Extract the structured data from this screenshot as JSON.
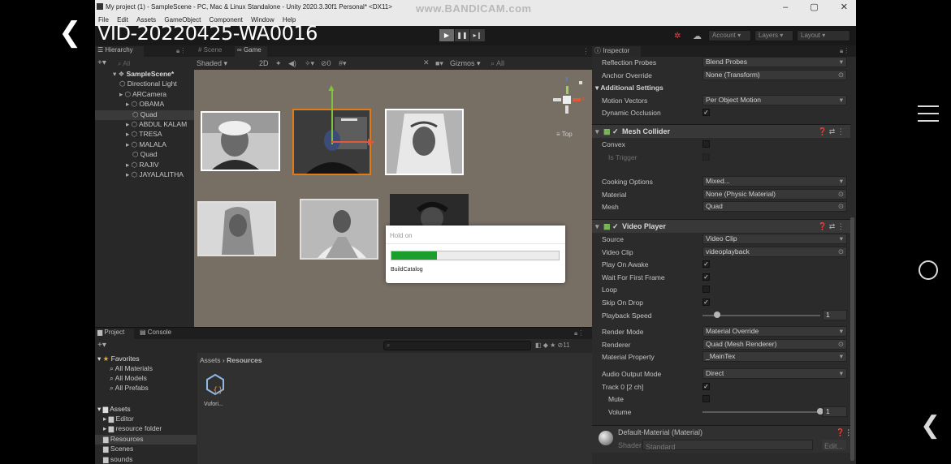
{
  "overlay": {
    "video_title": "VID-20220425-WA0016",
    "watermark": "www.BANDICAM.com"
  },
  "window": {
    "title": "My project (1) - SampleScene - PC, Mac & Linux Standalone - Unity 2020.3.30f1 Personal* <DX11>",
    "controls": [
      "–",
      "▢",
      "✕"
    ]
  },
  "menu": [
    "File",
    "Edit",
    "Assets",
    "GameObject",
    "Component",
    "Window",
    "Help"
  ],
  "toolbar": {
    "account": "Account",
    "layers": "Layers",
    "layout": "Layout"
  },
  "hierarchy": {
    "tab": "Hierarchy",
    "search_placeholder": "All",
    "items": [
      {
        "label": "SampleScene*",
        "depth": 0,
        "bold": true
      },
      {
        "label": "Directional Light",
        "depth": 1
      },
      {
        "label": "ARCamera",
        "depth": 1
      },
      {
        "label": "OBAMA",
        "depth": 2
      },
      {
        "label": "Quad",
        "depth": 3,
        "selected": true
      },
      {
        "label": "ABDUL KALAM",
        "depth": 2
      },
      {
        "label": "TRESA",
        "depth": 2
      },
      {
        "label": "MALALA",
        "depth": 2
      },
      {
        "label": "Quad",
        "depth": 3
      },
      {
        "label": "RAJIV",
        "depth": 2
      },
      {
        "label": "JAYALALITHA",
        "depth": 2
      }
    ]
  },
  "scene": {
    "tabs": [
      "Scene",
      "Game"
    ],
    "shading": "Shaded",
    "mode_2d": "2D",
    "gizmos": "Gizmos",
    "search_placeholder": "All",
    "gizmo_label": "Top"
  },
  "dialog": {
    "title": "Hold on",
    "progress": 0.27,
    "status": "BuildCatalog"
  },
  "inspector": {
    "tab": "Inspector",
    "rows_top": [
      {
        "label": "Reflection Probes",
        "value": "Blend Probes",
        "kind": "dropdown"
      },
      {
        "label": "Anchor Override",
        "value": "None (Transform)",
        "kind": "object"
      }
    ],
    "additional_settings": "Additional Settings",
    "rows_additional": [
      {
        "label": "Motion Vectors",
        "value": "Per Object Motion",
        "kind": "dropdown"
      },
      {
        "label": "Dynamic Occlusion",
        "value": "✓",
        "kind": "check"
      }
    ],
    "mesh_collider": {
      "title": "Mesh Collider",
      "rows": [
        {
          "label": "Convex",
          "value": "",
          "kind": "check"
        },
        {
          "label": "Is Trigger",
          "value": "",
          "kind": "check",
          "dim": true
        },
        {
          "label": "Cooking Options",
          "value": "Mixed...",
          "kind": "dropdown"
        },
        {
          "label": "Material",
          "value": "None (Physic Material)",
          "kind": "object"
        },
        {
          "label": "Mesh",
          "value": "Quad",
          "kind": "object"
        }
      ]
    },
    "video_player": {
      "title": "Video Player",
      "rows": [
        {
          "label": "Source",
          "value": "Video Clip",
          "kind": "dropdown"
        },
        {
          "label": "Video Clip",
          "value": "videoplayback",
          "kind": "object"
        },
        {
          "label": "Play On Awake",
          "value": "✓",
          "kind": "check"
        },
        {
          "label": "Wait For First Frame",
          "value": "✓",
          "kind": "check"
        },
        {
          "label": "Loop",
          "value": "",
          "kind": "check"
        },
        {
          "label": "Skip On Drop",
          "value": "✓",
          "kind": "check"
        },
        {
          "label": "Playback Speed",
          "value": "1",
          "kind": "slider",
          "level": 0.1
        },
        {
          "label": "Render Mode",
          "value": "Material Override",
          "kind": "dropdown"
        },
        {
          "label": "Renderer",
          "value": "Quad (Mesh Renderer)",
          "kind": "object"
        },
        {
          "label": "Material Property",
          "value": "_MainTex",
          "kind": "dropdown"
        },
        {
          "label": "Audio Output Mode",
          "value": "Direct",
          "kind": "dropdown"
        },
        {
          "label": "Track 0 [2 ch]",
          "value": "✓",
          "kind": "check"
        },
        {
          "label": "Mute",
          "value": "",
          "kind": "check",
          "indent": true
        },
        {
          "label": "Volume",
          "value": "1",
          "kind": "slider",
          "level": 1.0,
          "indent": true
        }
      ]
    },
    "material": {
      "title": "Default-Material (Material)",
      "shader_label": "Shader",
      "shader_value": "Standard",
      "edit": "Edit..."
    }
  },
  "project": {
    "tabs": [
      "Project",
      "Console"
    ],
    "hidden_count": "11",
    "favorites": "Favorites",
    "favorite_items": [
      "All Materials",
      "All Models",
      "All Prefabs"
    ],
    "assets": "Assets",
    "asset_items": [
      {
        "label": "Editor",
        "depth": 1
      },
      {
        "label": "resource folder",
        "depth": 1
      },
      {
        "label": "Resources",
        "depth": 1,
        "selected": true
      },
      {
        "label": "Scenes",
        "depth": 1
      },
      {
        "label": "sounds",
        "depth": 1
      }
    ],
    "breadcrumb": [
      "Assets",
      "Resources"
    ],
    "file_label": "Vufori..."
  }
}
